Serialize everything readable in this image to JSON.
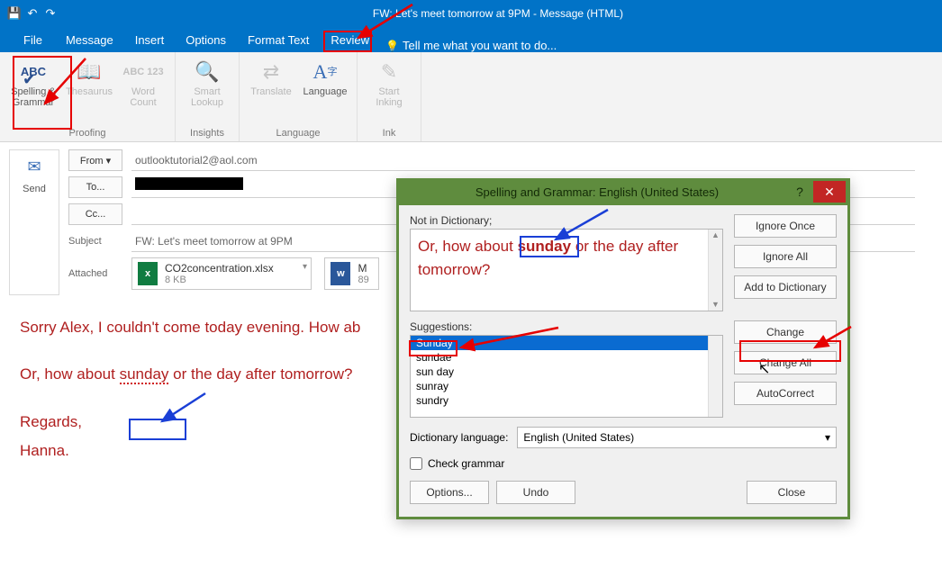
{
  "window": {
    "title": "FW: Let's meet tomorrow at 9PM - Message (HTML)"
  },
  "tabs": {
    "file": "File",
    "message": "Message",
    "insert": "Insert",
    "options": "Options",
    "format": "Format Text",
    "review": "Review",
    "tellme": "Tell me what you want to do..."
  },
  "ribbon": {
    "spelling": "Spelling & Grammar",
    "thesaurus": "Thesaurus",
    "wordcount": "Word Count",
    "smartlookup": "Smart Lookup",
    "translate": "Translate",
    "language": "Language",
    "startinking": "Start Inking",
    "grp_proofing": "Proofing",
    "grp_insights": "Insights",
    "grp_language": "Language",
    "grp_ink": "Ink",
    "abc": "ABC",
    "a123": "ABC 123"
  },
  "compose": {
    "send": "Send",
    "from_btn": "From ▾",
    "from_val": "outlooktutorial2@aol.com",
    "to_btn": "To...",
    "cc_btn": "Cc...",
    "subject_lbl": "Subject",
    "subject_val": "FW: Let's meet tomorrow at 9PM",
    "attached_lbl": "Attached",
    "att1_name": "CO2concentration.xlsx",
    "att1_size": "8 KB",
    "att2_name": "M",
    "att2_size": "89"
  },
  "body": {
    "p1a": "Sorry Alex, I couldn't come today evening. How ab",
    "p2a": "Or, how about ",
    "p2err": "sunday",
    "p2b": " or the day after tomorrow?",
    "p3": "Regards,",
    "p4": "Hanna."
  },
  "dialog": {
    "title": "Spelling and Grammar: English (United States)",
    "notdict_lbl": "Not in Dictionary;",
    "notdict_a": "Or, how about ",
    "notdict_err": "sunday",
    "notdict_b": " or the day after tomorrow?",
    "sugg_lbl": "Suggestions:",
    "suggestions": [
      "Sunday",
      "sundae",
      "sun day",
      "sunray",
      "sundry"
    ],
    "ignore_once": "Ignore Once",
    "ignore_all": "Ignore All",
    "add_dict": "Add to Dictionary",
    "change": "Change",
    "change_all": "Change All",
    "autocorrect": "AutoCorrect",
    "dict_lang_lbl": "Dictionary language:",
    "dict_lang_val": "English (United States)",
    "check_grammar": "Check grammar",
    "options": "Options...",
    "undo": "Undo",
    "close": "Close"
  }
}
